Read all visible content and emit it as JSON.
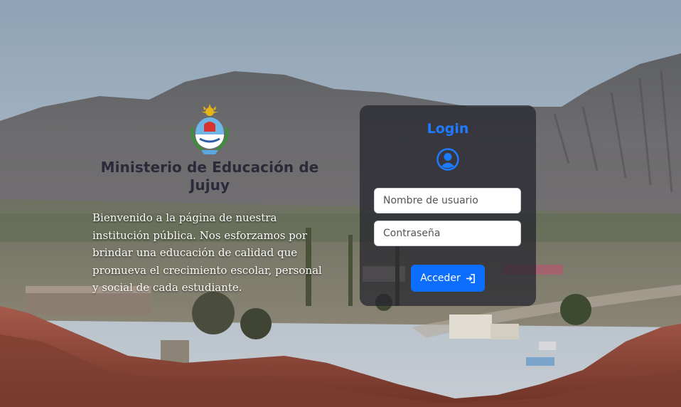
{
  "brand": {
    "title": "Ministerio de Educación de Jujuy",
    "welcome_text": "Bienvenido a la página de nuestra institución pública. Nos esforzamos por brindar una educación de calidad que promueva el crecimiento escolar, personal y social de cada estudiante."
  },
  "login": {
    "title": "Login",
    "username_placeholder": "Nombre de usuario",
    "password_placeholder": "Contraseña",
    "submit_label": "Acceder",
    "submit_icon": "login-arrow-icon",
    "user_icon": "user-circle-icon"
  },
  "colors": {
    "accent": "#1e7bff",
    "button": "#0d6efd",
    "card_bg": "rgba(36,36,44,0.74)"
  }
}
